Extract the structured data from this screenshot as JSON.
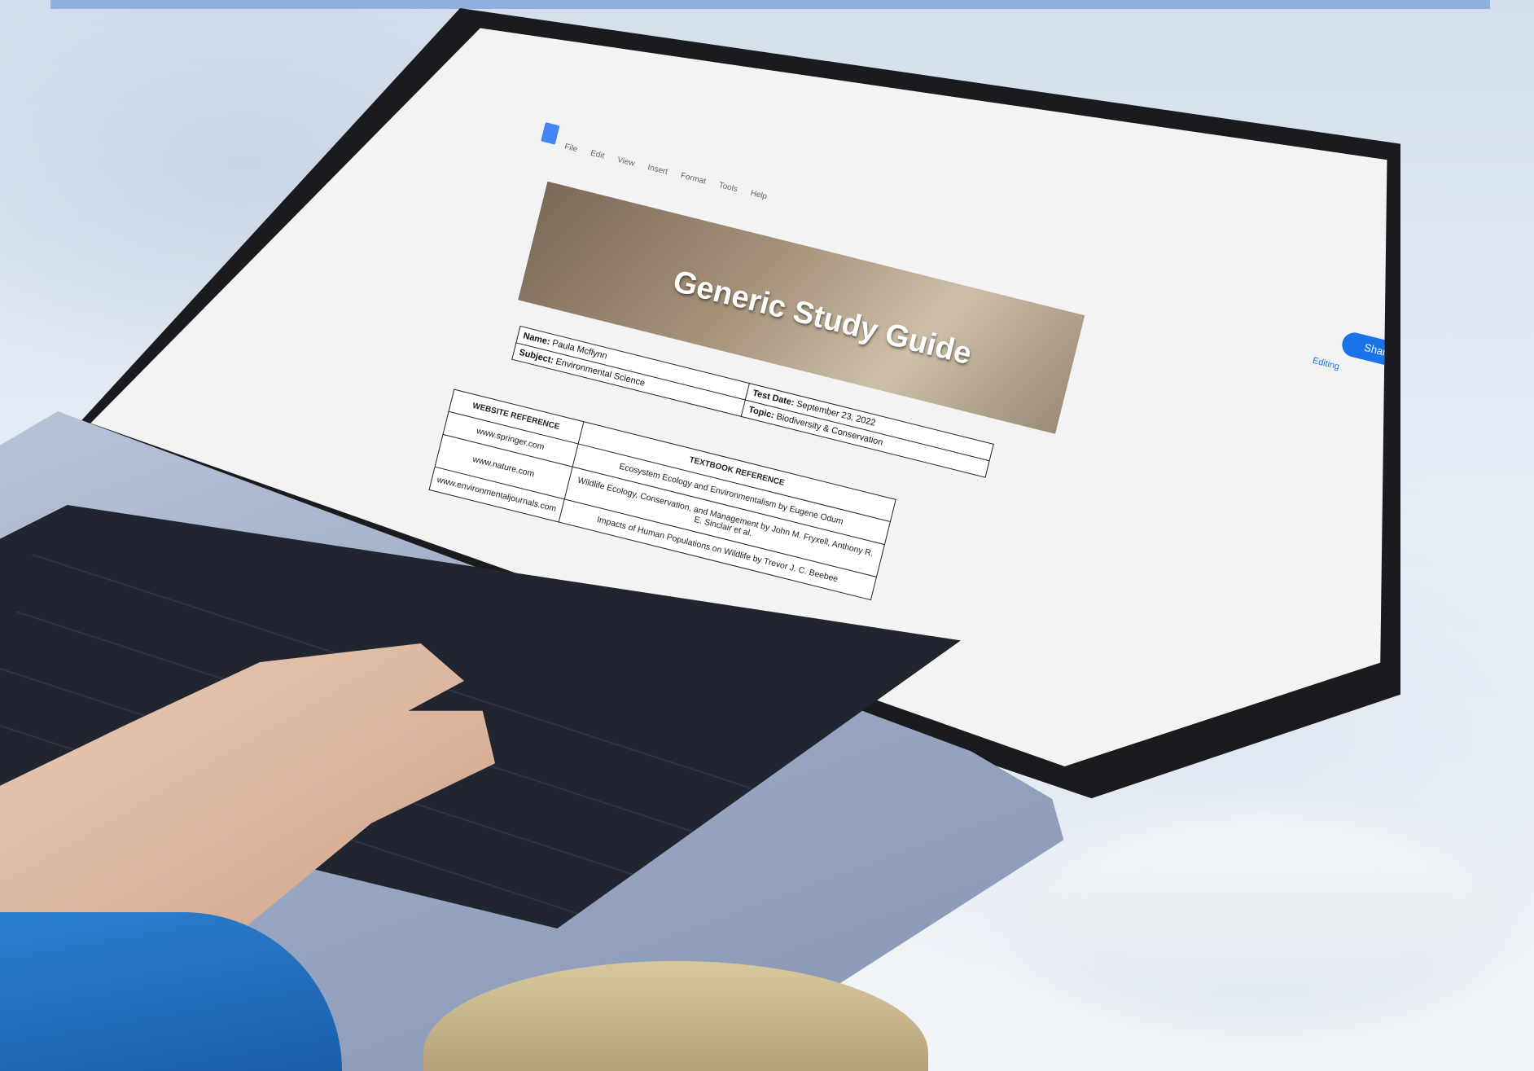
{
  "document": {
    "title": "Generic Study Guide",
    "menu": [
      "File",
      "Edit",
      "View",
      "Insert",
      "Format",
      "Tools",
      "Help"
    ],
    "share_label": "Share",
    "editing_label": "Editing"
  },
  "info": {
    "name_label": "Name:",
    "name_value": "Paula Mcflynn",
    "subject_label": "Subject:",
    "subject_value": "Environmental Science",
    "test_date_label": "Test Date:",
    "test_date_value": "September 23, 2022",
    "topic_label": "Topic:",
    "topic_value": "Biodiversity & Conservation"
  },
  "references": {
    "website_header": "WEBSITE REFERENCE",
    "textbook_header": "TEXTBOOK REFERENCE",
    "websites": [
      "www.springer.com",
      "www.nature.com",
      "www.environmentaljournals.com"
    ],
    "textbooks": [
      "Ecosystem Ecology and Environmentalism by Eugene Odum",
      "Wildlife Ecology, Conservation, and Management by John M. Fryxell, Anthony R. E. Sinclair et al.",
      "Impacts of Human Populations on Wildlife by Trevor J. C. Beebee"
    ]
  }
}
